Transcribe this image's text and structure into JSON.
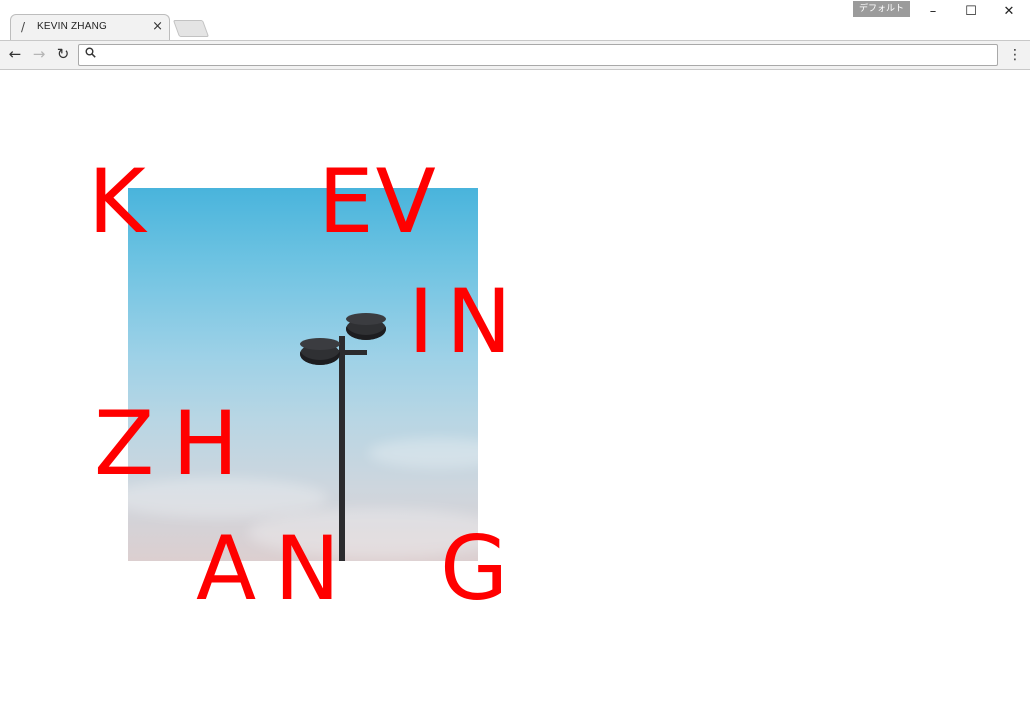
{
  "browser": {
    "tab": {
      "favicon": "/",
      "title": "KEVIN ZHANG",
      "close_icon": "×"
    },
    "profile_badge": "デフォルト",
    "window_controls": {
      "minimize": "–",
      "maximize": "☐",
      "close": "✕"
    },
    "toolbar": {
      "back": "←",
      "forward": "→",
      "reload": "↻",
      "search_icon": "🔍",
      "address_value": "",
      "menu": "⋮"
    }
  },
  "page": {
    "hero_image": {
      "subject": "street-lamp-against-sky"
    },
    "logo_letters": [
      "K",
      "EV",
      "IN",
      "ZH",
      "AN",
      "G"
    ],
    "accent_color": "#ff0000"
  }
}
